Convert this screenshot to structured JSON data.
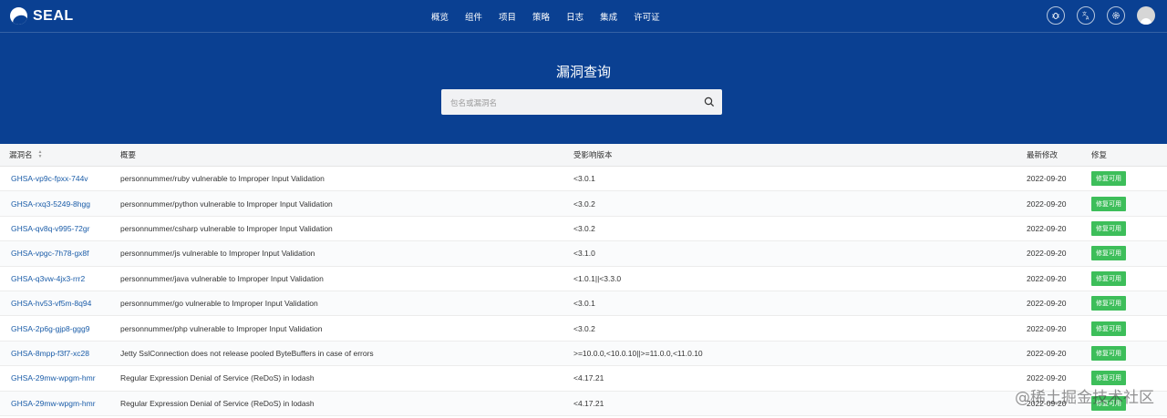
{
  "app": {
    "logo_text": "SEAL"
  },
  "nav": [
    "概览",
    "组件",
    "项目",
    "策略",
    "日志",
    "集成",
    "许可证"
  ],
  "page": {
    "title": "漏洞查询"
  },
  "search": {
    "placeholder": "包名或漏洞名",
    "value": ""
  },
  "table": {
    "headers": {
      "name": "漏洞名",
      "summary": "概要",
      "affected": "受影响版本",
      "modified": "最新修改",
      "fix": "修复"
    },
    "rows": [
      {
        "name": "GHSA-vp9c-fpxx-744v",
        "summary": "personnummer/ruby vulnerable to Improper Input Validation",
        "affected": "<3.0.1",
        "modified": "2022-09-20",
        "fix": "修复可用"
      },
      {
        "name": "GHSA-rxq3-5249-8hgg",
        "summary": "personnummer/python vulnerable to Improper Input Validation",
        "affected": "<3.0.2",
        "modified": "2022-09-20",
        "fix": "修复可用"
      },
      {
        "name": "GHSA-qv8q-v995-72gr",
        "summary": "personnummer/csharp vulnerable to Improper Input Validation",
        "affected": "<3.0.2",
        "modified": "2022-09-20",
        "fix": "修复可用"
      },
      {
        "name": "GHSA-vpgc-7h78-gx8f",
        "summary": "personnummer/js vulnerable to Improper Input Validation",
        "affected": "<3.1.0",
        "modified": "2022-09-20",
        "fix": "修复可用"
      },
      {
        "name": "GHSA-q3vw-4jx3-rrr2",
        "summary": "personnummer/java vulnerable to Improper Input Validation",
        "affected": "<1.0.1||<3.3.0",
        "modified": "2022-09-20",
        "fix": "修复可用"
      },
      {
        "name": "GHSA-hv53-vf5m-8q94",
        "summary": "personnummer/go vulnerable to Improper Input Validation",
        "affected": "<3.0.1",
        "modified": "2022-09-20",
        "fix": "修复可用"
      },
      {
        "name": "GHSA-2p6g-gjp8-ggg9",
        "summary": "personnummer/php vulnerable to Improper Input Validation",
        "affected": "<3.0.2",
        "modified": "2022-09-20",
        "fix": "修复可用"
      },
      {
        "name": "GHSA-8mpp-f3f7-xc28",
        "summary": "Jetty SslConnection does not release pooled ByteBuffers in case of errors",
        "affected": ">=10.0.0,<10.0.10||>=11.0.0,<11.0.10",
        "modified": "2022-09-20",
        "fix": "修复可用"
      },
      {
        "name": "GHSA-29mw-wpgm-hmr",
        "summary": "Regular Expression Denial of Service (ReDoS) in lodash",
        "affected": "<4.17.21",
        "modified": "2022-09-20",
        "fix": "修复可用"
      },
      {
        "name": "GHSA-29mw-wpgm-hmr",
        "summary": "Regular Expression Denial of Service (ReDoS) in lodash",
        "affected": "<4.17.21",
        "modified": "2022-09-20",
        "fix": "修复可用"
      }
    ]
  },
  "watermark": "@稀土掘金技术社区",
  "colors": {
    "header_bg": "#0a4092",
    "link": "#1a5ca8",
    "badge": "#3dbe5a"
  }
}
